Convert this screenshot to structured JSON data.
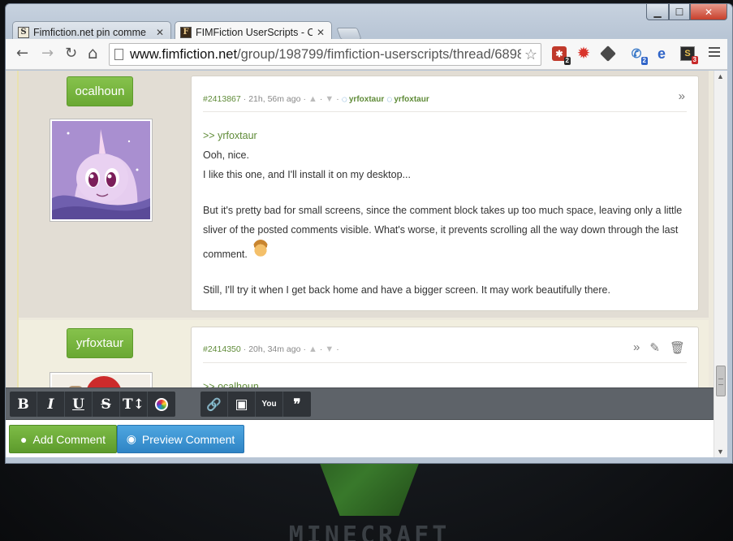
{
  "desktop": {
    "wallpaper_text": "MINECRAFT"
  },
  "window": {
    "minimize": "▁",
    "maximize": "☐",
    "close": "✕"
  },
  "tabs": [
    {
      "favicon": "S",
      "title": "Fimfiction.net pin comme",
      "close": "✕"
    },
    {
      "favicon": "F",
      "title": "FIMFiction UserScripts - C",
      "close": "✕"
    }
  ],
  "toolbar": {
    "back": "←",
    "forward": "→",
    "reload": "↻",
    "home": "⌂",
    "url_host": "www.fimfiction.net",
    "url_path": "/group/198799/fimfiction-userscripts/thread/6898",
    "star": "☆",
    "extensions": [
      {
        "icon": "puzzle-icon",
        "badge": "2"
      },
      {
        "icon": "gear-burst-icon",
        "badge": ""
      },
      {
        "icon": "tag-icon",
        "badge": ""
      },
      {
        "icon": "phone-icon",
        "badge": "2"
      },
      {
        "icon": "e-icon",
        "badge": ""
      },
      {
        "icon": "s-icon",
        "badge": "3"
      }
    ]
  },
  "comments": [
    {
      "author": "ocalhoun",
      "id": "#2413867",
      "time": "21h, 56m ago",
      "replies": [
        "yrfoxtaur",
        "yrfoxtaur"
      ],
      "quote": ">> yrfoxtaur",
      "lines": [
        "Ooh, nice.",
        "I like this one, and I'll install it on my desktop..."
      ],
      "para2": "But it's pretty bad for small screens, since the comment block takes up too much space, leaving only a little sliver of the posted comments visible. What's worse, it prevents scrolling all the way down through the last comment.",
      "para3": "Still, I'll try it when I get back home and have a bigger screen. It may work beautifully there."
    },
    {
      "author": "yrfoxtaur",
      "id": "#2414350",
      "time": "20h, 34m ago",
      "quote": ">> ocalhoun"
    }
  ],
  "meta_separator": "·",
  "editor": {
    "tools": [
      "B",
      "I",
      "U",
      "S",
      "TI"
    ],
    "bold": "B",
    "italic": "I",
    "underline": "U",
    "strike": "S",
    "size": "T↕",
    "link": "🔗",
    "image": "▣",
    "youtube": "You",
    "quote": "❞"
  },
  "buttons": {
    "add_comment": "Add Comment",
    "preview_comment": "Preview Comment"
  },
  "scrollbar": {
    "up": "▲",
    "down": "▼"
  }
}
